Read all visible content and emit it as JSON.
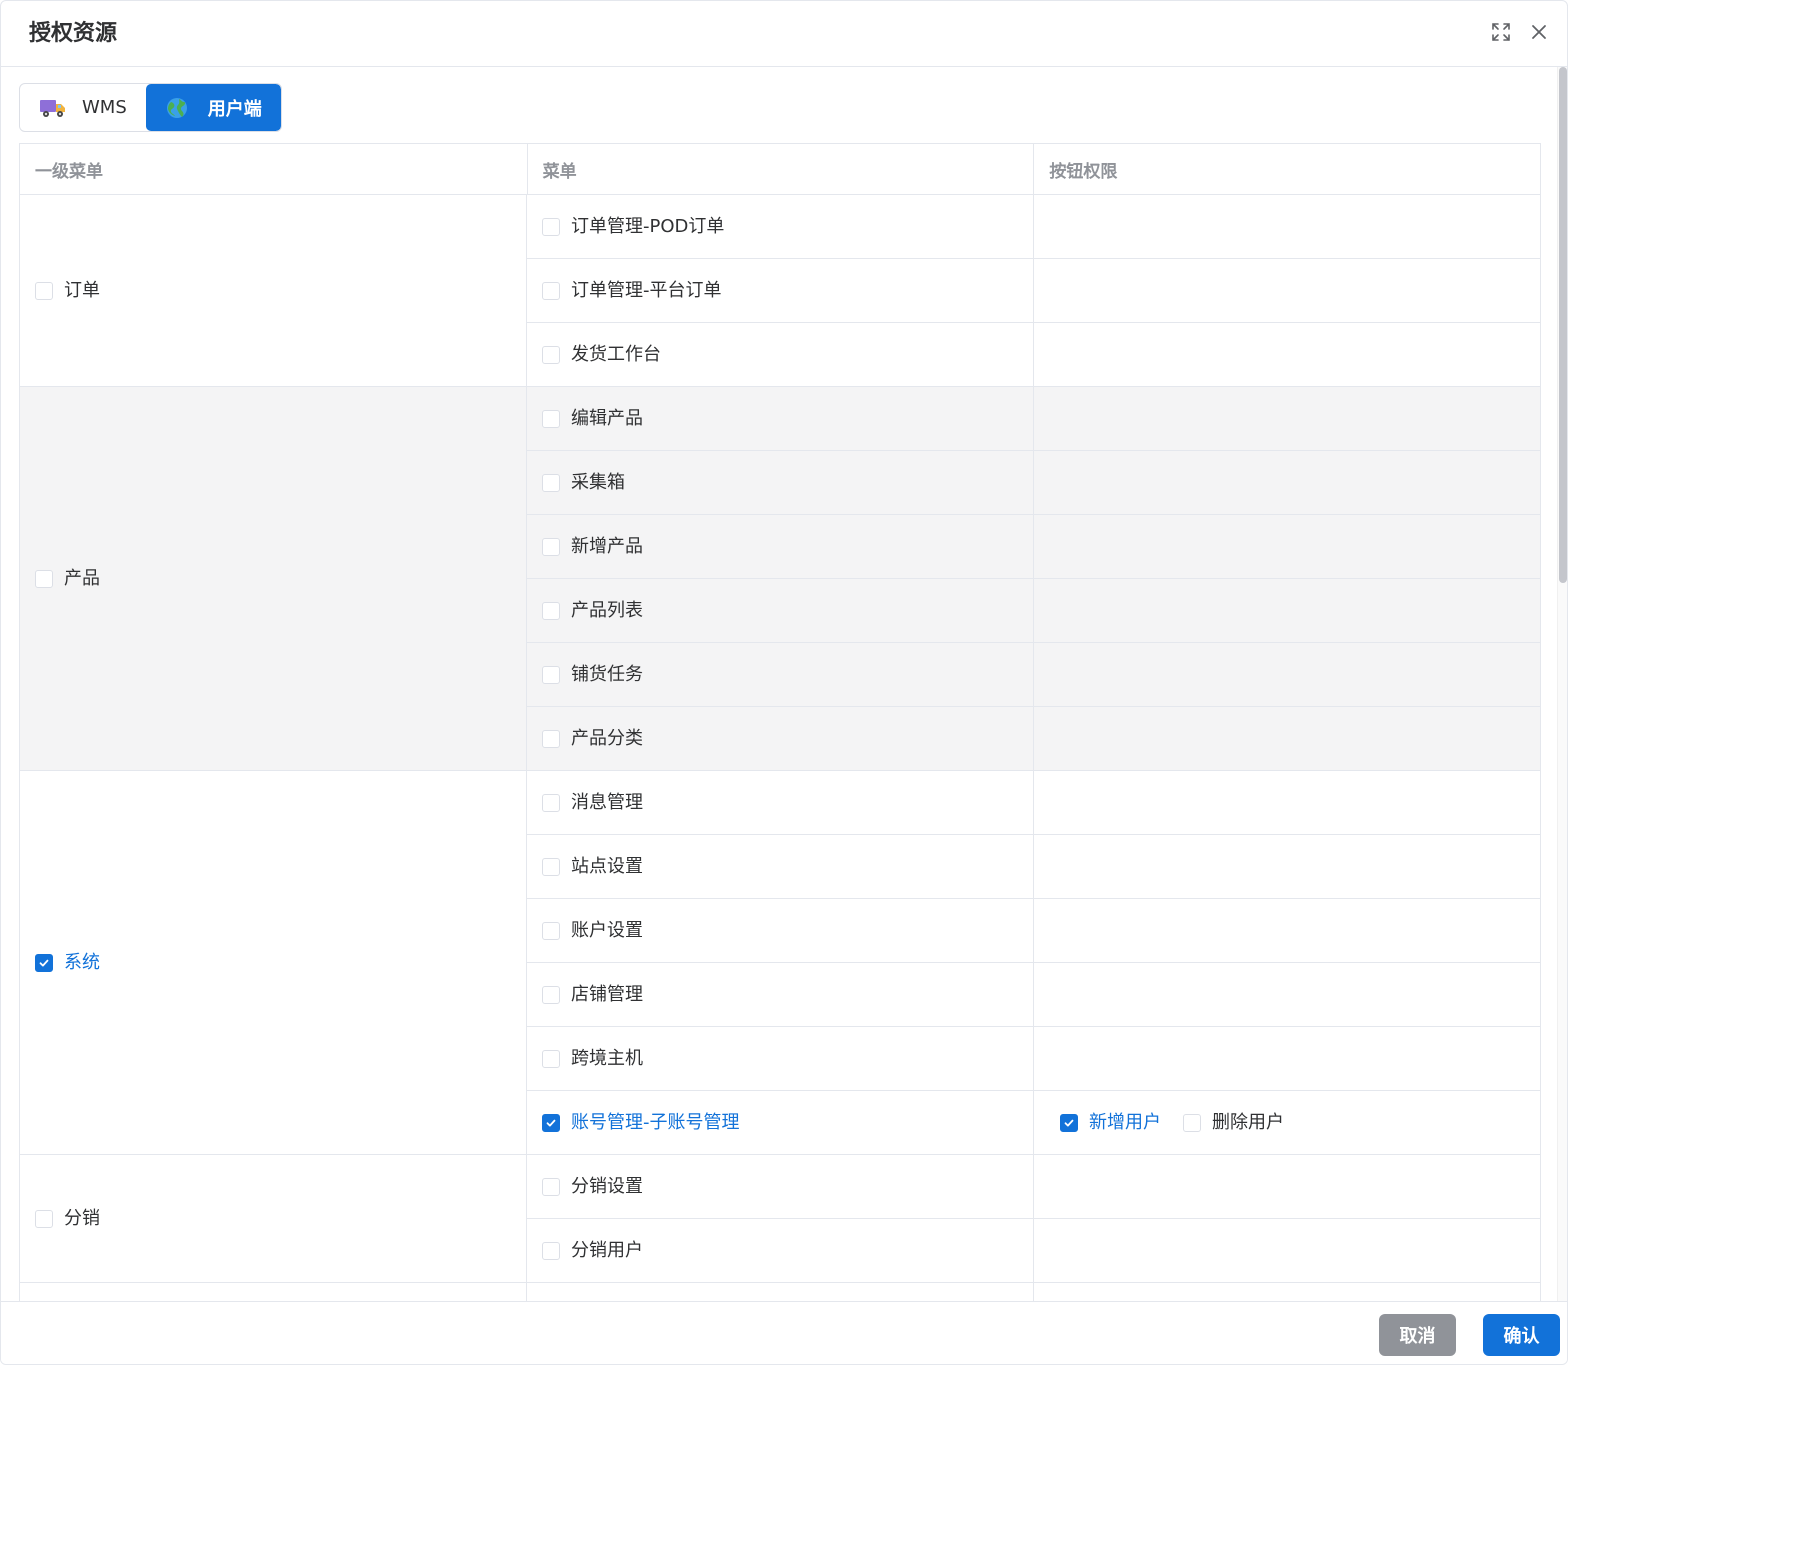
{
  "dialog": {
    "title": "授权资源",
    "fullscreen_icon": "fullscreen-icon",
    "close_icon": "close-icon"
  },
  "tabs": [
    {
      "label": "WMS",
      "icon": "truck-icon",
      "active": false
    },
    {
      "label": "用户端",
      "icon": "globe-icon",
      "active": true
    }
  ],
  "table": {
    "headers": [
      "一级菜单",
      "菜单",
      "按钮权限"
    ],
    "groups": [
      {
        "name": "订单",
        "checked": false,
        "menus": [
          {
            "label": "订单管理-POD订单",
            "checked": false,
            "buttons": []
          },
          {
            "label": "订单管理-平台订单",
            "checked": false,
            "buttons": []
          },
          {
            "label": "发货工作台",
            "checked": false,
            "buttons": []
          }
        ]
      },
      {
        "name": "产品",
        "checked": false,
        "menus": [
          {
            "label": "编辑产品",
            "checked": false,
            "buttons": []
          },
          {
            "label": "采集箱",
            "checked": false,
            "buttons": []
          },
          {
            "label": "新增产品",
            "checked": false,
            "buttons": []
          },
          {
            "label": "产品列表",
            "checked": false,
            "buttons": []
          },
          {
            "label": "铺货任务",
            "checked": false,
            "buttons": []
          },
          {
            "label": "产品分类",
            "checked": false,
            "buttons": []
          }
        ]
      },
      {
        "name": "系统",
        "checked": true,
        "menus": [
          {
            "label": "消息管理",
            "checked": false,
            "buttons": []
          },
          {
            "label": "站点设置",
            "checked": false,
            "buttons": []
          },
          {
            "label": "账户设置",
            "checked": false,
            "buttons": []
          },
          {
            "label": "店铺管理",
            "checked": false,
            "buttons": []
          },
          {
            "label": "跨境主机",
            "checked": false,
            "buttons": []
          },
          {
            "label": "账号管理-子账号管理",
            "checked": true,
            "buttons": [
              {
                "label": "新增用户",
                "checked": true
              },
              {
                "label": "删除用户",
                "checked": false
              }
            ]
          }
        ]
      },
      {
        "name": "分销",
        "checked": false,
        "menus": [
          {
            "label": "分销设置",
            "checked": false,
            "buttons": []
          },
          {
            "label": "分销用户",
            "checked": false,
            "buttons": []
          }
        ]
      },
      {
        "name": "",
        "checked": false,
        "menus": [
          {
            "label": "",
            "checked": false,
            "buttons": []
          }
        ]
      }
    ]
  },
  "footer": {
    "cancel_label": "取消",
    "confirm_label": "确认"
  },
  "colors": {
    "primary": "#1272d9",
    "cancel": "#909399",
    "shaded_row": "#f4f4f5"
  }
}
